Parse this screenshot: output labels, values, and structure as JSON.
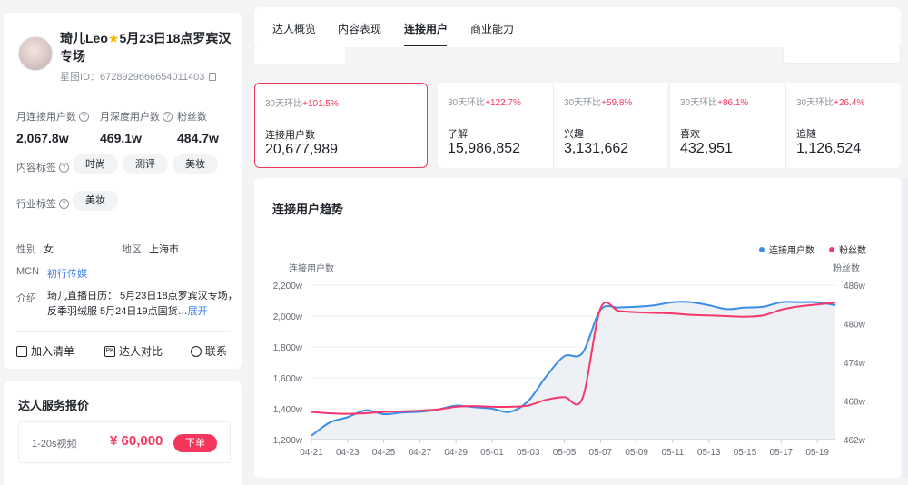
{
  "profile": {
    "name_part1": "琦儿Leo",
    "name_part2": "5月23日18点罗宾汉专场",
    "star_id": "星图ID：6728929666654011403"
  },
  "stats": [
    {
      "label": "月连接用户数",
      "value": "2,067.8w"
    },
    {
      "label": "月深度用户数",
      "value": "469.1w"
    },
    {
      "label": "粉丝数",
      "value": "484.7w"
    }
  ],
  "content_tags": {
    "label": "内容标签",
    "tags": [
      "时尚",
      "测评",
      "美妆"
    ]
  },
  "industry_tags": {
    "label": "行业标签",
    "tags": [
      "美妆"
    ]
  },
  "info": {
    "gender_label": "性别",
    "gender": "女",
    "region_label": "地区",
    "region": "上海市",
    "mcn_label": "MCN",
    "mcn": "初行传媒",
    "intro_label": "介绍",
    "intro": "琦儿直播日历： 5月23日18点罗宾汉专场，反季羽绒服 5月24日19点国货…",
    "expand": "展开"
  },
  "actions": {
    "add_list": "加入清单",
    "compare": "达人对比",
    "contact": "联系"
  },
  "price": {
    "title": "达人服务报价",
    "type": "1-20s视频",
    "value": "¥ 60,000",
    "order": "下单"
  },
  "tabs": [
    "达人概览",
    "内容表现",
    "连接用户",
    "商业能力"
  ],
  "active_tab": "连接用户",
  "metrics": [
    {
      "prefix": "30天环比",
      "change": "+101.5%",
      "label": "连接用户数",
      "value": "20,677,989",
      "selected": true
    },
    {
      "prefix": "30天环比",
      "change": "+122.7%",
      "label": "了解",
      "value": "15,986,852"
    },
    {
      "prefix": "30天环比",
      "change": "+59.8%",
      "label": "兴趣",
      "value": "3,131,662"
    },
    {
      "prefix": "30天环比",
      "change": "+86.1%",
      "label": "喜欢",
      "value": "432,951"
    },
    {
      "prefix": "30天环比",
      "change": "+26.4%",
      "label": "追随",
      "value": "1,126,524"
    }
  ],
  "colors": {
    "accent": "#f5365c",
    "series_blue": "#3a8ee6",
    "series_pink": "#f5376d"
  },
  "chart_data": {
    "type": "line",
    "title": "连接用户趋势",
    "legend": [
      "连接用户数",
      "粉丝数"
    ],
    "legend_position": "top-right",
    "y_left_label": "连接用户数",
    "y_right_label": "粉丝数",
    "y_left_ticks": [
      "2,200w",
      "2,000w",
      "1,800w",
      "1,600w",
      "1,400w",
      "1,200w"
    ],
    "y_right_ticks": [
      "486w",
      "480w",
      "474w",
      "468w",
      "462w"
    ],
    "x_ticks": [
      "04-21",
      "04-23",
      "04-25",
      "04-27",
      "04-29",
      "05-01",
      "05-03",
      "05-05",
      "05-07",
      "05-09",
      "05-11",
      "05-13",
      "05-15",
      "05-17",
      "05-19"
    ],
    "ylim_left": [
      1200,
      2200
    ],
    "ylim_right": [
      462,
      486
    ],
    "x_dates": [
      "04-21",
      "04-22",
      "04-23",
      "04-24",
      "04-25",
      "04-26",
      "04-27",
      "04-28",
      "04-29",
      "04-30",
      "05-01",
      "05-02",
      "05-03",
      "05-04",
      "05-05",
      "05-06",
      "05-07",
      "05-08",
      "05-09",
      "05-10",
      "05-11",
      "05-12",
      "05-13",
      "05-14",
      "05-15",
      "05-16",
      "05-17",
      "05-18",
      "05-19",
      "05-20"
    ],
    "series": [
      {
        "name": "连接用户数",
        "axis": "left",
        "values": [
          1225,
          1310,
          1345,
          1390,
          1365,
          1375,
          1380,
          1395,
          1420,
          1410,
          1400,
          1380,
          1450,
          1610,
          1740,
          1760,
          2040,
          2055,
          2060,
          2070,
          2090,
          2090,
          2070,
          2045,
          2055,
          2060,
          2090,
          2090,
          2090,
          2070
        ]
      },
      {
        "name": "粉丝数",
        "axis": "right",
        "values": [
          466.3,
          466.1,
          466.0,
          466.1,
          466.3,
          466.4,
          466.5,
          466.7,
          467.1,
          467.2,
          467.1,
          467.1,
          467.3,
          468.2,
          468.6,
          468.4,
          482.4,
          482.0,
          481.8,
          481.7,
          481.6,
          481.4,
          481.3,
          481.2,
          481.1,
          481.3,
          482.2,
          482.7,
          483.0,
          483.3
        ]
      }
    ]
  }
}
